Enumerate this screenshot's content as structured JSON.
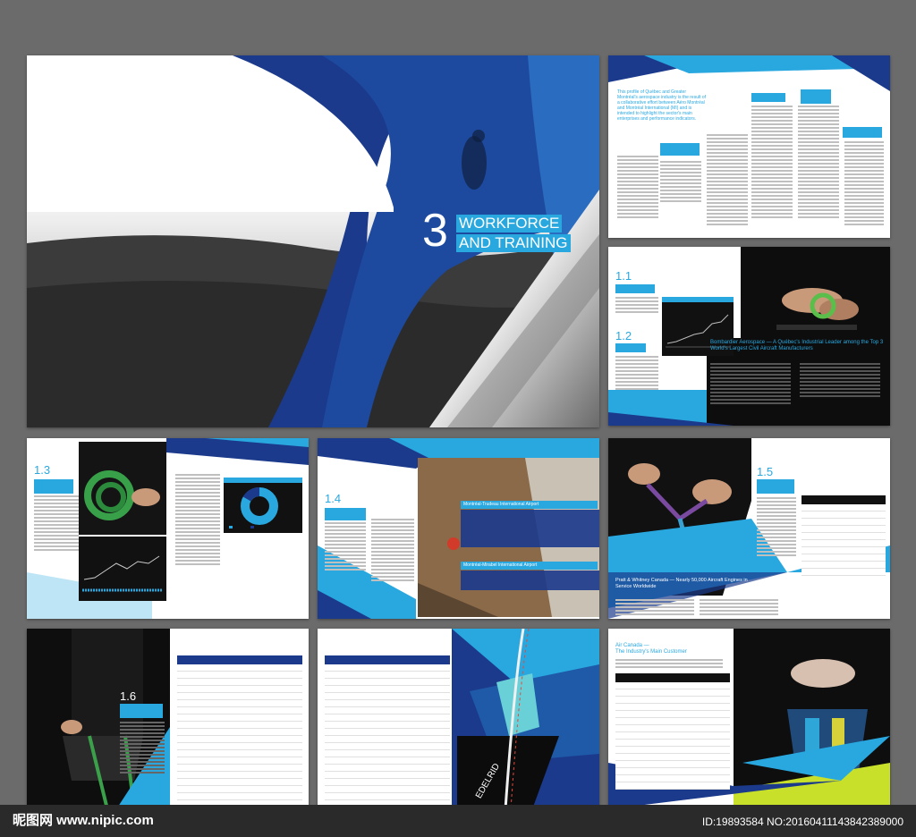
{
  "spread1": {
    "chapter_number": "3",
    "chapter_title_line1": "WORKFORCE",
    "chapter_title_line2": "AND TRAINING"
  },
  "page2": {
    "intro": "This profile of Québec and Greater Montréal's aerospace industry is the result of a collaborative effort between Aéro Montréal and Montréal International (MI) and is intended to highlight the sector's main enterprises and performance indicators."
  },
  "page3": {
    "sec1_num": "1.1",
    "sec2_num": "1.2",
    "feature": "Bombardier Aerospace — A Québec's Industrial Leader among the Top 3 World's Largest Civil Aircraft Manufacturers"
  },
  "page4": {
    "sec_num": "1.3"
  },
  "page5": {
    "sec_num": "1.4",
    "banner1": "Montréal-Trudeau International Airport",
    "banner2": "Montréal-Mirabel International Airport"
  },
  "page6": {
    "sec_num": "1.5",
    "feature": "Pratt & Whitney Canada — Nearly 50,000 Aircraft Engines in Service Worldwide"
  },
  "page7": {
    "sec_num": "1.6"
  },
  "page9": {
    "feature_line1": "Air Canada —",
    "feature_line2": "The Industry's Main Customer"
  },
  "watermark": {
    "left": "昵图网 www.nipic.com",
    "right": "ID:19893584 NO:20160411143842389000"
  },
  "colors": {
    "accent": "#29a8e0",
    "navy": "#1b3a8c",
    "background": "#6b6b6b"
  }
}
